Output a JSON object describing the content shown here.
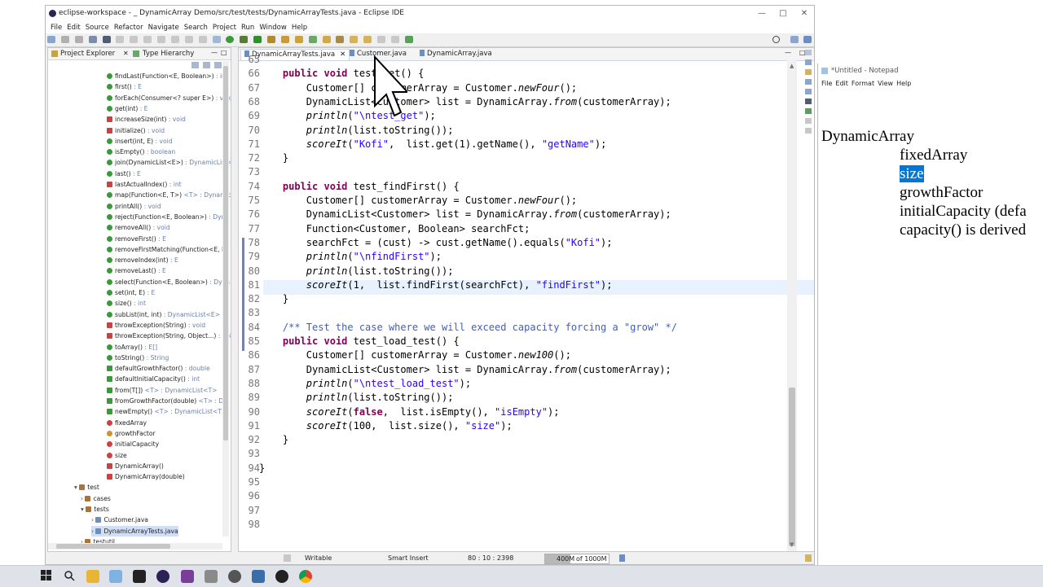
{
  "eclipse": {
    "title": "eclipse-workspace - _ DynamicArray Demo/src/test/tests/DynamicArrayTests.java - Eclipse IDE",
    "menu": [
      "File",
      "Edit",
      "Source",
      "Refactor",
      "Navigate",
      "Search",
      "Project",
      "Run",
      "Window",
      "Help"
    ],
    "left_tabs": [
      "Project Explorer",
      "Type Hierarchy"
    ],
    "editor_tabs": [
      "DynamicArrayTests.java",
      "Customer.java",
      "DynamicArray.java"
    ]
  },
  "tree": [
    {
      "label": "findLast(Function<E, Boolean>)",
      "suffix": " : int",
      "indent": 130,
      "kind": "pub"
    },
    {
      "label": "first()",
      "suffix": " : E",
      "indent": 130,
      "kind": "pub"
    },
    {
      "label": "forEach(Consumer<? super E>)",
      "suffix": " : void",
      "indent": 130,
      "kind": "pub"
    },
    {
      "label": "get(int)",
      "suffix": " : E",
      "indent": 130,
      "kind": "pub"
    },
    {
      "label": "increaseSize(int)",
      "suffix": " : void",
      "indent": 130,
      "kind": "priv"
    },
    {
      "label": "initialize()",
      "suffix": " : void",
      "indent": 130,
      "kind": "priv"
    },
    {
      "label": "insert(int, E)",
      "suffix": " : void",
      "indent": 130,
      "kind": "pub"
    },
    {
      "label": "isEmpty()",
      "suffix": " : boolean",
      "indent": 130,
      "kind": "pub"
    },
    {
      "label": "join(DynamicList<E>)",
      "suffix": " : DynamicList<E>",
      "indent": 130,
      "kind": "pub"
    },
    {
      "label": "last()",
      "suffix": " : E",
      "indent": 130,
      "kind": "pub"
    },
    {
      "label": "lastActualIndex()",
      "suffix": " : int",
      "indent": 130,
      "kind": "priv"
    },
    {
      "label": "map(Function<E, T>)",
      "suffix": " <T> : Dynamic",
      "indent": 130,
      "kind": "pub"
    },
    {
      "label": "printAll()",
      "suffix": " : void",
      "indent": 130,
      "kind": "pub"
    },
    {
      "label": "reject(Function<E, Boolean>)",
      "suffix": " : Dyna",
      "indent": 130,
      "kind": "pub"
    },
    {
      "label": "removeAll()",
      "suffix": " : void",
      "indent": 130,
      "kind": "pub"
    },
    {
      "label": "removeFirst()",
      "suffix": " : E",
      "indent": 130,
      "kind": "pub"
    },
    {
      "label": "removeFirstMatching(Function<E, B",
      "suffix": "",
      "indent": 130,
      "kind": "pub"
    },
    {
      "label": "removeIndex(int)",
      "suffix": " : E",
      "indent": 130,
      "kind": "pub"
    },
    {
      "label": "removeLast()",
      "suffix": " : E",
      "indent": 130,
      "kind": "pub"
    },
    {
      "label": "select(Function<E, Boolean>)",
      "suffix": " : Dyna",
      "indent": 130,
      "kind": "pub"
    },
    {
      "label": "set(int, E)",
      "suffix": " : E",
      "indent": 130,
      "kind": "pub"
    },
    {
      "label": "size()",
      "suffix": " : int",
      "indent": 130,
      "kind": "pub"
    },
    {
      "label": "subList(int, int)",
      "suffix": " : DynamicList<E>",
      "indent": 130,
      "kind": "pub"
    },
    {
      "label": "throwException(String)",
      "suffix": " : void",
      "indent": 130,
      "kind": "priv"
    },
    {
      "label": "throwException(String, Object...)",
      "suffix": " : voi",
      "indent": 130,
      "kind": "priv"
    },
    {
      "label": "toArray()",
      "suffix": " : E[]",
      "indent": 130,
      "kind": "pub"
    },
    {
      "label": "toString()",
      "suffix": " : String",
      "indent": 130,
      "kind": "pub"
    },
    {
      "label": "defaultGrowthFactor()",
      "suffix": " : double",
      "indent": 130,
      "kind": "static"
    },
    {
      "label": "defaultInitialCapacity()",
      "suffix": " : int",
      "indent": 130,
      "kind": "static"
    },
    {
      "label": "from(T[])",
      "suffix": " <T> : DynamicList<T>",
      "indent": 130,
      "kind": "static"
    },
    {
      "label": "fromGrowthFactor(double)",
      "suffix": " <T> : Dy",
      "indent": 130,
      "kind": "static"
    },
    {
      "label": "newEmpty()",
      "suffix": " <T> : DynamicList<T>",
      "indent": 130,
      "kind": "static"
    },
    {
      "label": "fixedArray",
      "suffix": "",
      "indent": 130,
      "kind": "field"
    },
    {
      "label": "growthFactor",
      "suffix": "",
      "indent": 130,
      "kind": "final"
    },
    {
      "label": "initialCapacity",
      "suffix": "",
      "indent": 130,
      "kind": "field"
    },
    {
      "label": "size",
      "suffix": "",
      "indent": 130,
      "kind": "field"
    },
    {
      "label": "DynamicArray()",
      "suffix": "",
      "indent": 130,
      "kind": "ctor"
    },
    {
      "label": "DynamicArray(double)",
      "suffix": "",
      "indent": 130,
      "kind": "ctor"
    },
    {
      "label": "test",
      "suffix": "",
      "indent": 90,
      "kind": "pkg"
    },
    {
      "label": "cases",
      "suffix": "",
      "indent": 98,
      "kind": "pkg"
    },
    {
      "label": "tests",
      "suffix": "",
      "indent": 98,
      "kind": "pkg"
    },
    {
      "label": "Customer.java",
      "suffix": "",
      "indent": 111,
      "kind": "java"
    },
    {
      "label": "DynamicArrayTests.java",
      "suffix": "",
      "indent": 111,
      "kind": "java",
      "selected": true
    },
    {
      "label": "testutil",
      "suffix": "",
      "indent": 98,
      "kind": "pkg"
    }
  ],
  "code": {
    "line_numbers": [
      "65",
      "66",
      "67",
      "68",
      "69",
      "70",
      "71",
      "72",
      "73",
      "74",
      "75",
      "76",
      "77",
      "78",
      "79",
      "80",
      "81",
      "82",
      "83",
      "84",
      "85",
      "86",
      "87",
      "88",
      "89",
      "90",
      "91",
      "92",
      "93",
      "94",
      "95",
      "96",
      "97",
      "98"
    ],
    "lines": [
      [
        [
          "pl",
          ""
        ]
      ],
      [
        [
          "pl",
          "    "
        ],
        [
          "kw",
          "public"
        ],
        [
          "pl",
          " "
        ],
        [
          "kw",
          "void"
        ],
        [
          "pl",
          " test_get() {"
        ]
      ],
      [
        [
          "pl",
          "        Customer[] customerArray = Customer."
        ],
        [
          "it",
          "newFour"
        ],
        [
          "pl",
          "();"
        ]
      ],
      [
        [
          "pl",
          "        DynamicList<Customer> list = DynamicArray."
        ],
        [
          "it",
          "from"
        ],
        [
          "pl",
          "(customerArray);"
        ]
      ],
      [
        [
          "pl",
          "        "
        ],
        [
          "it",
          "println"
        ],
        [
          "pl",
          "("
        ],
        [
          "str",
          "\"\\ntest_get\""
        ],
        [
          "pl",
          ");"
        ]
      ],
      [
        [
          "pl",
          "        "
        ],
        [
          "it",
          "println"
        ],
        [
          "pl",
          "(list.toString());"
        ]
      ],
      [
        [
          "pl",
          "        "
        ],
        [
          "it",
          "scoreIt"
        ],
        [
          "pl",
          "("
        ],
        [
          "str",
          "\"Kofi\""
        ],
        [
          "pl",
          ",  list.get(1).getName(), "
        ],
        [
          "str",
          "\"getName\""
        ],
        [
          "pl",
          ");"
        ]
      ],
      [
        [
          "pl",
          "    }"
        ]
      ],
      [
        [
          "pl",
          ""
        ]
      ],
      [
        [
          "pl",
          "    "
        ],
        [
          "kw",
          "public"
        ],
        [
          "pl",
          " "
        ],
        [
          "kw",
          "void"
        ],
        [
          "pl",
          " test_findFirst() {"
        ]
      ],
      [
        [
          "pl",
          "        Customer[] customerArray = Customer."
        ],
        [
          "it",
          "newFour"
        ],
        [
          "pl",
          "();"
        ]
      ],
      [
        [
          "pl",
          "        DynamicList<Customer> list = DynamicArray."
        ],
        [
          "it",
          "from"
        ],
        [
          "pl",
          "(customerArray);"
        ]
      ],
      [
        [
          "pl",
          "        Function<Customer, Boolean> searchFct;"
        ]
      ],
      [
        [
          "pl",
          "        searchFct = (cust) -> cust.getName().equals("
        ],
        [
          "str",
          "\"Kofi\""
        ],
        [
          "pl",
          ");"
        ]
      ],
      [
        [
          "pl",
          "        "
        ],
        [
          "it",
          "println"
        ],
        [
          "pl",
          "("
        ],
        [
          "str",
          "\"\\nfindFirst\""
        ],
        [
          "pl",
          ");"
        ]
      ],
      [
        [
          "pl",
          "        "
        ],
        [
          "it",
          "println"
        ],
        [
          "pl",
          "(list.toString());"
        ]
      ],
      [
        [
          "pl",
          "        "
        ],
        [
          "it",
          "scoreIt"
        ],
        [
          "pl",
          "(1,  list.findFirst(searchFct), "
        ],
        [
          "str",
          "\"findFirst\""
        ],
        [
          "pl",
          ");"
        ]
      ],
      [
        [
          "pl",
          "    }"
        ]
      ],
      [
        [
          "pl",
          ""
        ]
      ],
      [
        [
          "pl",
          "    "
        ],
        [
          "cm",
          "/** Test the case where we will exceed capacity forcing a \"grow\" */"
        ]
      ],
      [
        [
          "pl",
          "    "
        ],
        [
          "kw",
          "public"
        ],
        [
          "pl",
          " "
        ],
        [
          "kw",
          "void"
        ],
        [
          "pl",
          " test_load_test() {"
        ]
      ],
      [
        [
          "pl",
          "        Customer[] customerArray = Customer."
        ],
        [
          "it",
          "new100"
        ],
        [
          "pl",
          "();"
        ]
      ],
      [
        [
          "pl",
          "        DynamicList<Customer> list = DynamicArray."
        ],
        [
          "it",
          "from"
        ],
        [
          "pl",
          "(customerArray);"
        ]
      ],
      [
        [
          "pl",
          "        "
        ],
        [
          "it",
          "println"
        ],
        [
          "pl",
          "("
        ],
        [
          "str",
          "\"\\ntest_load_test\""
        ],
        [
          "pl",
          ");"
        ]
      ],
      [
        [
          "pl",
          "        "
        ],
        [
          "it",
          "println"
        ],
        [
          "pl",
          "(list.toString());"
        ]
      ],
      [
        [
          "pl",
          "        "
        ],
        [
          "it",
          "scoreIt"
        ],
        [
          "pl",
          "("
        ],
        [
          "kw",
          "false"
        ],
        [
          "pl",
          ",  list.isEmpty(), "
        ],
        [
          "str",
          "\"isEmpty\""
        ],
        [
          "pl",
          ");"
        ]
      ],
      [
        [
          "pl",
          "        "
        ],
        [
          "it",
          "scoreIt"
        ],
        [
          "pl",
          "(100,  list.size(), "
        ],
        [
          "str",
          "\"size\""
        ],
        [
          "pl",
          ");"
        ]
      ],
      [
        [
          "pl",
          "    }"
        ]
      ],
      [
        [
          "pl",
          ""
        ]
      ],
      [
        [
          "pl",
          "}"
        ]
      ],
      [
        [
          "pl",
          ""
        ]
      ],
      [
        [
          "pl",
          ""
        ]
      ],
      [
        [
          "pl",
          ""
        ]
      ],
      [
        [
          "pl",
          ""
        ]
      ]
    ]
  },
  "status": {
    "writable": "Writable",
    "insert_mode": "Smart Insert",
    "position": "80 : 10 : 2398",
    "heap_used": "400M",
    "heap_total": "of 1000M",
    "heap_fraction": 0.4
  },
  "notepad": {
    "title": "*Untitled - Notepad",
    "menu": [
      "File",
      "Edit",
      "Format",
      "View",
      "Help"
    ],
    "lines": [
      {
        "text": "DynamicArray",
        "indent": false,
        "highlight": false
      },
      {
        "text": "fixedArray",
        "indent": true,
        "highlight": false
      },
      {
        "text": "size",
        "indent": true,
        "highlight": true
      },
      {
        "text": "growthFactor",
        "indent": true,
        "highlight": false
      },
      {
        "text": "initialCapacity (defa",
        "indent": true,
        "highlight": false
      },
      {
        "text": "capacity() is derived",
        "indent": true,
        "highlight": false
      }
    ]
  },
  "colors": {
    "keyword": "#7f0055",
    "string": "#2a00ff",
    "comment": "#3f5fbf",
    "current_line": "#e8f2fe",
    "selection": "#0078d7"
  }
}
